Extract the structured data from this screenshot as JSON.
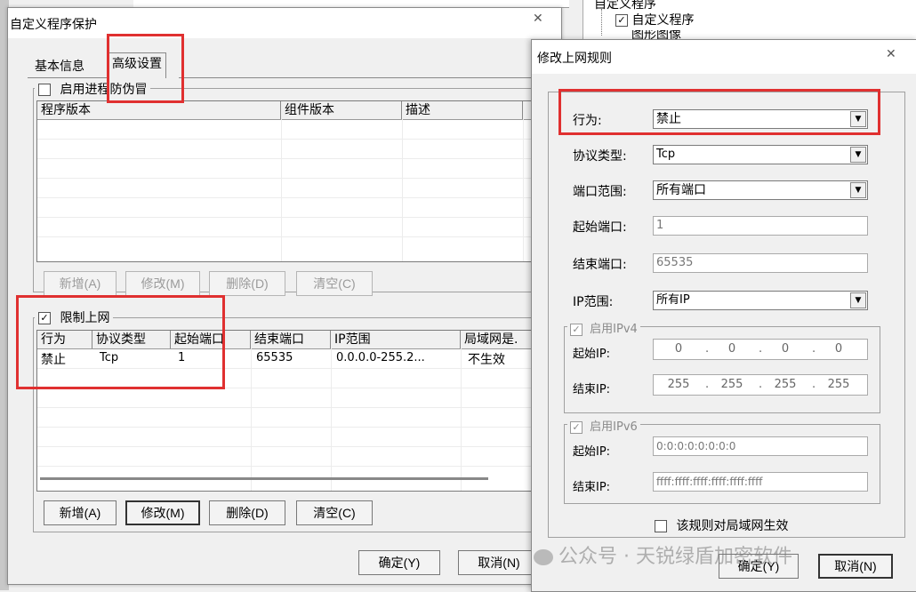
{
  "background": {
    "right_tree_root": "自定义程序",
    "right_tree_item1": "自定义程序",
    "right_tree_item2": "图形图像"
  },
  "main_window": {
    "title": "自定义程序保护",
    "tabs": [
      "基本信息",
      "高级设置"
    ],
    "anti_spoof_label": "启用进程防伪冒",
    "program_table": {
      "columns": [
        "程序版本",
        "组件版本",
        "描述"
      ]
    },
    "buttons_top": {
      "add": "新增(A)",
      "modify": "修改(M)",
      "delete": "删除(D)",
      "clear": "清空(C)"
    },
    "limit_label": "限制上网",
    "rules_table": {
      "columns": [
        "行为",
        "协议类型",
        "起始端口",
        "结束端口",
        "IP范围",
        "局域网是."
      ],
      "rows": [
        {
          "action": "禁止",
          "protocol": "Tcp",
          "start": "1",
          "end": "65535",
          "ip": "0.0.0.0-255.2...",
          "lan": "不生效"
        }
      ]
    },
    "buttons_bottom": {
      "add": "新增(A)",
      "modify": "修改(M)",
      "delete": "删除(D)",
      "clear": "清空(C)"
    },
    "ok": "确定(Y)",
    "cancel": "取消(N)"
  },
  "dialog": {
    "title": "修改上网规则",
    "action_label": "行为:",
    "action_value": "禁止",
    "protocol_label": "协议类型:",
    "protocol_value": "Tcp",
    "port_range_label": "端口范围:",
    "port_range_value": "所有端口",
    "start_port_label": "起始端口:",
    "start_port_value": "1",
    "end_port_label": "结束端口:",
    "end_port_value": "65535",
    "ip_range_label": "IP范围:",
    "ip_range_value": "所有IP",
    "ipv4": {
      "label": "启用IPv4",
      "start_label": "起始IP:",
      "end_label": "结束IP:",
      "start": [
        "0",
        "0",
        "0",
        "0"
      ],
      "end": [
        "255",
        "255",
        "255",
        "255"
      ]
    },
    "ipv6": {
      "label": "启用IPv6",
      "start_label": "起始IP:",
      "end_label": "结束IP:",
      "start": "0:0:0:0:0:0:0:0",
      "end": "ffff:ffff:ffff:ffff:ffff:ffff"
    },
    "lan_label": "该规则对局域网生效",
    "ok": "确定(Y)",
    "cancel": "取消(N)"
  },
  "watermark": "公众号 · 天锐绿盾加密软件"
}
